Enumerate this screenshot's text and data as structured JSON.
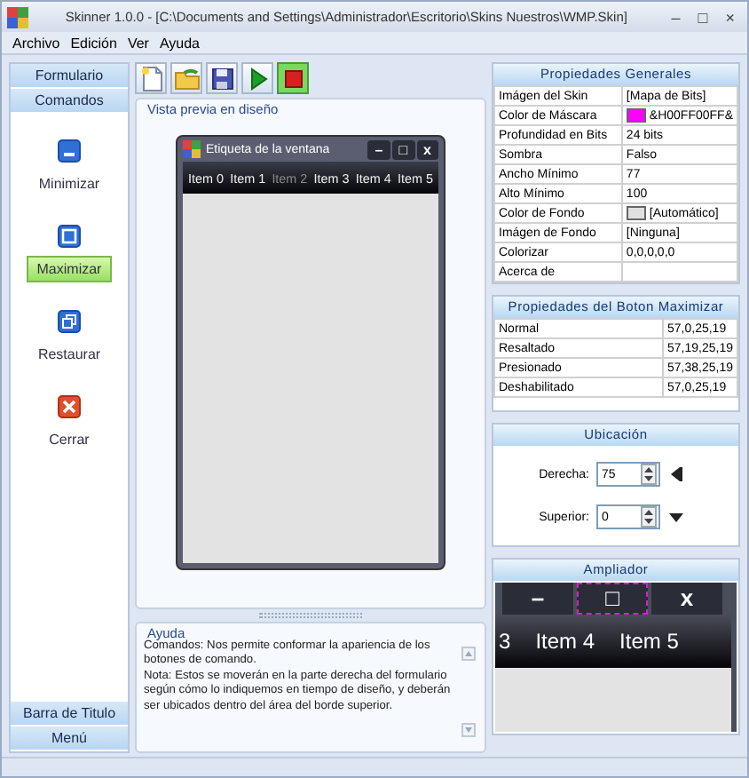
{
  "window": {
    "title": "Skinner 1.0.0 - [C:\\Documents and Settings\\Administrador\\Escritorio\\Skins Nuestros\\WMP.Skin]",
    "controls": [
      "–",
      "□",
      "×"
    ]
  },
  "menu": [
    "Archivo",
    "Edición",
    "Ver",
    "Ayuda"
  ],
  "sidebar": {
    "top": [
      {
        "label": "Formulario"
      },
      {
        "label": "Comandos"
      }
    ],
    "items": [
      {
        "label": "Minimizar",
        "kind": "minimize",
        "selected": false
      },
      {
        "label": "Maximizar",
        "kind": "maximize",
        "selected": true
      },
      {
        "label": "Restaurar",
        "kind": "restore",
        "selected": false
      },
      {
        "label": "Cerrar",
        "kind": "close",
        "selected": false
      }
    ],
    "bottom": [
      {
        "label": "Barra de Titulo"
      },
      {
        "label": "Menú"
      }
    ]
  },
  "toolbar": [
    {
      "kind": "new",
      "pressed": false
    },
    {
      "kind": "open",
      "pressed": false
    },
    {
      "kind": "save",
      "pressed": false
    },
    {
      "kind": "play",
      "pressed": false
    },
    {
      "kind": "stop",
      "pressed": true
    }
  ],
  "preview": {
    "title": "Vista previa en diseño",
    "window_title": "Etiqueta de la ventana",
    "window_buttons": [
      "–",
      "□",
      "x"
    ],
    "items": [
      {
        "label": "Item 0",
        "dimmed": false
      },
      {
        "label": "Item 1",
        "dimmed": false
      },
      {
        "label": "Item 2",
        "dimmed": true
      },
      {
        "label": "Item 3",
        "dimmed": false
      },
      {
        "label": "Item 4",
        "dimmed": false
      },
      {
        "label": "Item 5",
        "dimmed": false
      }
    ]
  },
  "help": {
    "title": "Ayuda",
    "text": "Comandos: Nos permite conformar la apariencia de los botones de comando.\nNota: Estos se moverán en la parte derecha del formulario según cómo lo indiquemos en tiempo de diseño, y deberán ser ubicados dentro del área del borde superior."
  },
  "general": {
    "title": "Propiedades Generales",
    "rows": [
      {
        "name": "Imágen del Skin",
        "value": "[Mapa de Bits]"
      },
      {
        "name": "Color de Máscara",
        "value": "&H00FF00FF&",
        "color": "#ff00ff"
      },
      {
        "name": "Profundidad en Bits",
        "value": "24 bits"
      },
      {
        "name": "Sombra",
        "value": "Falso"
      },
      {
        "name": "Ancho Mínimo",
        "value": "77"
      },
      {
        "name": "Alto Mínimo",
        "value": "100"
      },
      {
        "name": "Color de Fondo",
        "value": "[Automático]",
        "color": "#e0e0e0"
      },
      {
        "name": "Imágen de Fondo",
        "value": "[Ninguna]"
      },
      {
        "name": "Colorizar",
        "value": "0,0,0,0,0"
      },
      {
        "name": "Acerca de"
      }
    ]
  },
  "button_props": {
    "title": "Propiedades del Boton Maximizar",
    "rows": [
      {
        "name": "Normal",
        "value": "57,0,25,19"
      },
      {
        "name": "Resaltado",
        "value": "57,19,25,19"
      },
      {
        "name": "Presionado",
        "value": "57,38,25,19"
      },
      {
        "name": "Deshabilitado",
        "value": "57,0,25,19"
      }
    ]
  },
  "location": {
    "title": "Ubicación",
    "fields": [
      {
        "label": "Derecha:",
        "value": "75",
        "kind": "right"
      },
      {
        "label": "Superior:",
        "value": "0",
        "kind": "down"
      }
    ]
  },
  "magnifier": {
    "title": "Ampliador",
    "buttons": [
      "–",
      "□",
      "x"
    ],
    "items": [
      "3",
      "Item 4",
      "Item 5"
    ]
  }
}
